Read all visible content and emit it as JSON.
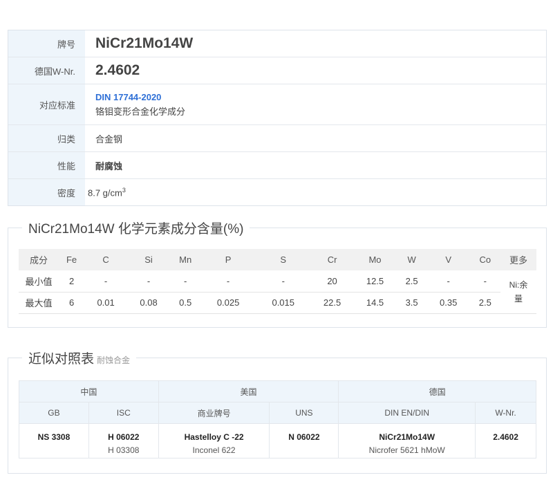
{
  "spec": {
    "grade_label": "牌号",
    "grade_value": "NiCr21Mo14W",
    "wnr_label": "德国W-Nr.",
    "wnr_value": "2.4602",
    "standard_label": "对应标准",
    "standard_link": "DIN 17744-2020",
    "standard_desc": "铬钼变形合金化学成分",
    "category_label": "归类",
    "category_value": "合金钢",
    "property_label": "性能",
    "property_value": "耐腐蚀",
    "density_label": "密度",
    "density_value": "8.7 g/cm",
    "density_exp": "3"
  },
  "chem": {
    "title": "NiCr21Mo14W 化学元素成分含量(%)",
    "header": [
      "成分",
      "Fe",
      "C",
      "Si",
      "Mn",
      "P",
      "S",
      "Cr",
      "Mo",
      "W",
      "V",
      "Co",
      "更多"
    ],
    "min_row": [
      "最小值",
      "2",
      "-",
      "-",
      "-",
      "-",
      "-",
      "20",
      "12.5",
      "2.5",
      "-",
      "-"
    ],
    "max_row": [
      "最大值",
      "6",
      "0.01",
      "0.08",
      "0.5",
      "0.025",
      "0.015",
      "22.5",
      "14.5",
      "3.5",
      "0.35",
      "2.5"
    ],
    "more_line1": "Ni:余",
    "more_line2": "量"
  },
  "compare": {
    "title": "近似对照表",
    "subtitle": "耐蚀合金",
    "countries": [
      "中国",
      "美国",
      "德国"
    ],
    "columns": [
      "GB",
      "ISC",
      "商业牌号",
      "UNS",
      "DIN EN/DIN",
      "W-Nr."
    ],
    "cells": [
      {
        "main": "NS 3308",
        "alt": ""
      },
      {
        "main": "H 06022",
        "alt": "H 03308"
      },
      {
        "main": "Hastelloy C -22",
        "alt": "Inconel 622"
      },
      {
        "main": "N 06022",
        "alt": ""
      },
      {
        "main": "NiCr21Mo14W",
        "alt": "Nicrofer 5621 hMoW"
      },
      {
        "main": "2.4602",
        "alt": ""
      }
    ]
  }
}
